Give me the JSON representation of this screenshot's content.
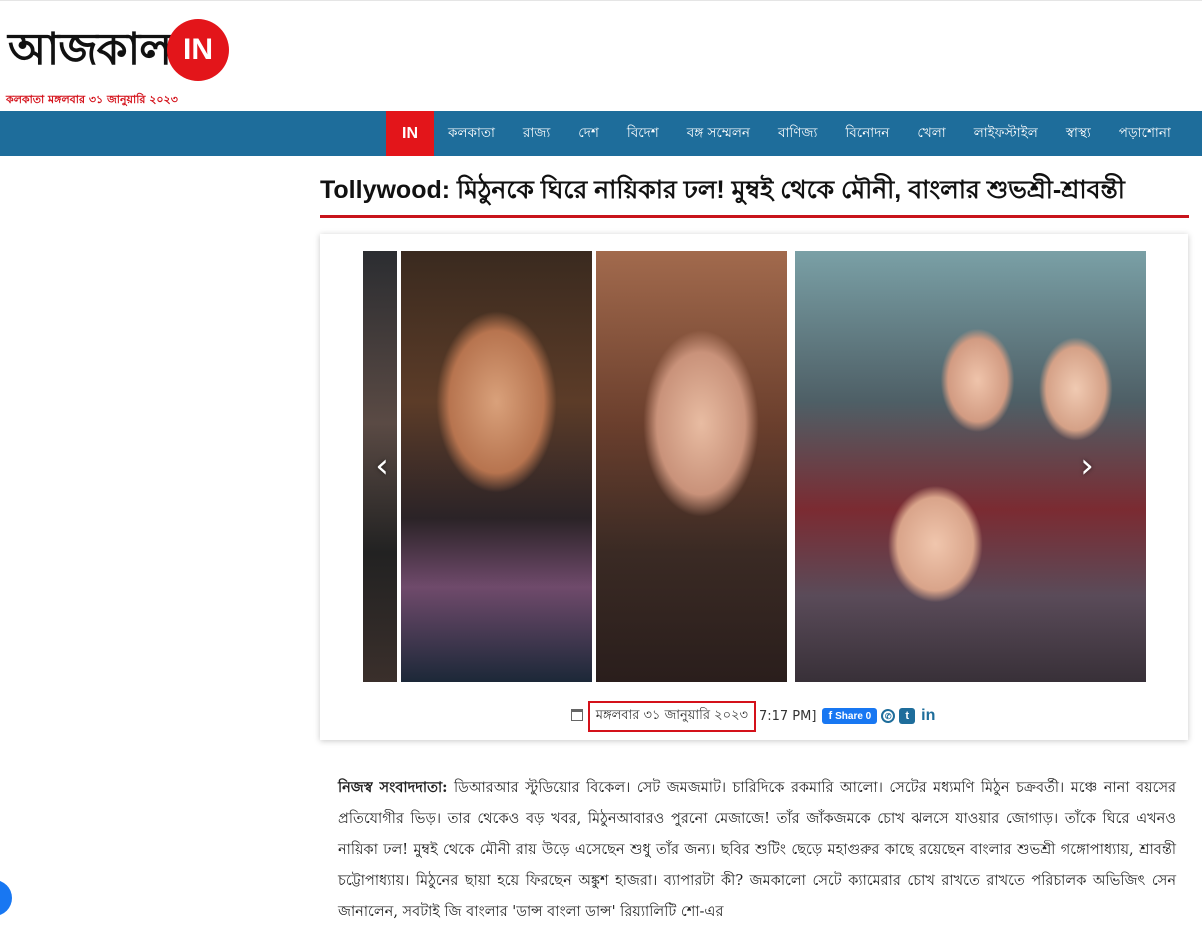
{
  "header": {
    "logo_text": "আজকাল",
    "logo_badge": "IN",
    "dateline": "কলকাতা মঙ্গলবার ৩১ জানুয়ারি ২০২৩"
  },
  "nav": {
    "home_badge": "IN",
    "items": [
      "কলকাতা",
      "রাজ্য",
      "দেশ",
      "বিদেশ",
      "বঙ্গ সম্মেলন",
      "বাণিজ্য",
      "বিনোদন",
      "খেলা",
      "লাইফস্টাইল",
      "স্বাস্থ্য",
      "পড়াশোনা"
    ]
  },
  "article": {
    "headline": "Tollywood: মিঠুনকে ঘিরে নায়িকার ঢল! মুম্বই থেকে মৌনী, বাংলার শুভশ্রী-শ্রাবন্তী",
    "date": "মঙ্গলবার ৩১ জানুয়ারি ২০২৩",
    "time": "7:17 PM]",
    "share_label": "Share 0",
    "byline": "নিজস্ব সংবাদদাতা:",
    "body": "ডিআরআর স্টুডিয়োর বিকেল। সেট জমজমাট। চারিদিকে রকমারি আলো। সেটের মধ্যমণি মিঠুন চক্রবর্তী। মঞ্চে নানা বয়সের প্রতিযোগীর ভিড়। তার থেকেও বড় খবর, মিঠুনআবারও পুরনো মেজাজে! তাঁর জাঁকজমকে চোখ ঝলসে যাওয়ার জোগাড়। তাঁকে ঘিরে এখনও নায়িকা ঢল! মুম্বই থেকে মৌনী রায় উড়ে এসেছেন শুধু তাঁর জন্য। ছবির শুটিং ছেড়ে মহাগুরুর কাছে রয়েছেন বাংলার শুভশ্রী গঙ্গোপাধ্যায়, শ্রাবন্তী চট্টোপাধ্যায়। মিঠুনের ছায়া হয়ে ফিরছেন অঙ্কুশ হাজরা। ব্যাপারটা কী? জমকালো সেটে ক্যামেরার চোখ রাখতে রাখতে পরিচালক অভিজিৎ সেন জানালেন, সবটাই জি বাংলার 'ডান্স বাংলা ডান্স' রিয়্যালিটি শো-এর"
  },
  "icons": {
    "prev": "‹",
    "next": "›",
    "facebook": "f",
    "whatsapp": "✆",
    "twitter": "t",
    "linkedin": "in"
  },
  "colors": {
    "brand_red": "#e3151a",
    "nav_blue": "#1e6d9b",
    "facebook_blue": "#1877f2"
  }
}
